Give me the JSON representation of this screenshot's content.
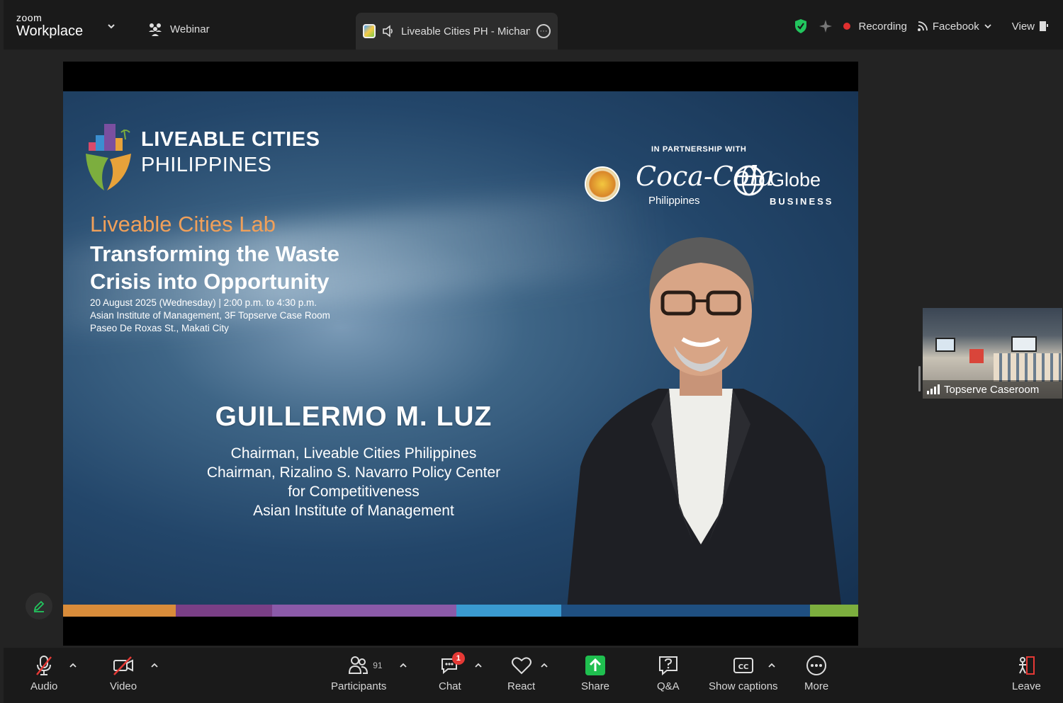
{
  "app": {
    "brand_small": "zoom",
    "brand_large": "Workplace"
  },
  "topbar": {
    "webinar_label": "Webinar",
    "tab_title": "Liveable Cities PH - Michan's",
    "recording_label": "Recording",
    "stream_label": "Facebook",
    "view_label": "View"
  },
  "slide": {
    "org_line1": "LIVEABLE CITIES",
    "org_line2": "PHILIPPINES",
    "partnership_label": "IN PARTNERSHIP WITH",
    "partner_coke": "Coca-Cola",
    "partner_coke_sub": "Philippines",
    "partner_globe": "Globe",
    "partner_globe_sub": "BUSINESS",
    "lab_title": "Liveable Cities Lab",
    "headline_line1": "Transforming the Waste",
    "headline_line2": "Crisis into Opportunity",
    "date_line": "20 August 2025 (Wednesday) | 2:00 p.m. to 4:30 p.m.",
    "venue_line1": "Asian Institute of Management, 3F Topserve Case Room",
    "venue_line2": "Paseo De Roxas St., Makati City",
    "speaker_name": "GUILLERMO M. LUZ",
    "speaker_title1": "Chairman, Liveable Cities Philippines",
    "speaker_title2": "Chairman, Rizalino S. Navarro Policy Center",
    "speaker_title3": "for Competitiveness",
    "speaker_title4": "Asian Institute of Management",
    "colorbar": [
      "#d98c3a",
      "#7a3f86",
      "#8b5aa8",
      "#3a9ad0",
      "#1f4f80",
      "#7cae3e"
    ]
  },
  "thumbnail": {
    "label": "Topserve Caseroom"
  },
  "toolbar": {
    "audio": "Audio",
    "video": "Video",
    "participants": "Participants",
    "participants_count": "91",
    "chat": "Chat",
    "chat_badge": "1",
    "react": "React",
    "share": "Share",
    "qa": "Q&A",
    "captions": "Show captions",
    "more": "More",
    "leave": "Leave"
  },
  "colors": {
    "share_green": "#1fbf4f",
    "recording_red": "#e02f2f",
    "leave_red": "#e53935",
    "shield_green": "#22c55e"
  }
}
